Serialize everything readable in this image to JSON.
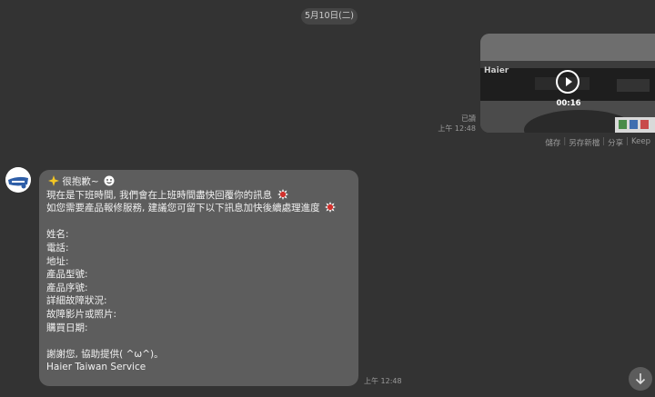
{
  "date_separator": "5月10日(二)",
  "sent_video": {
    "duration": "00:16",
    "read_label": "已讀",
    "time": "上午 12:48",
    "actions": [
      "儲存",
      "另存新檔",
      "分享",
      "Keep"
    ],
    "overlay_text": "Haier"
  },
  "received_message": {
    "greeting": "很抱歉~",
    "line1": "現在是下班時間, 我們會在上班時間盡快回覆你的訊息",
    "line2": "如您需要產品報修服務, 建議您可留下以下訊息加快後續處理進度",
    "fields": [
      "姓名:",
      "電話:",
      "地址:",
      "產品型號:",
      "產品序號:",
      "詳細故障狀況:",
      "故障影片或照片:",
      "購買日期:"
    ],
    "thanks": "謝謝您, 協助提供( ^ω^)。",
    "signature": "Haier Taiwan Service",
    "time": "上午 12:48"
  },
  "colors": {
    "background": "#333333",
    "bubble": "#5d5d5d",
    "meta_text": "#9a9a9a"
  }
}
